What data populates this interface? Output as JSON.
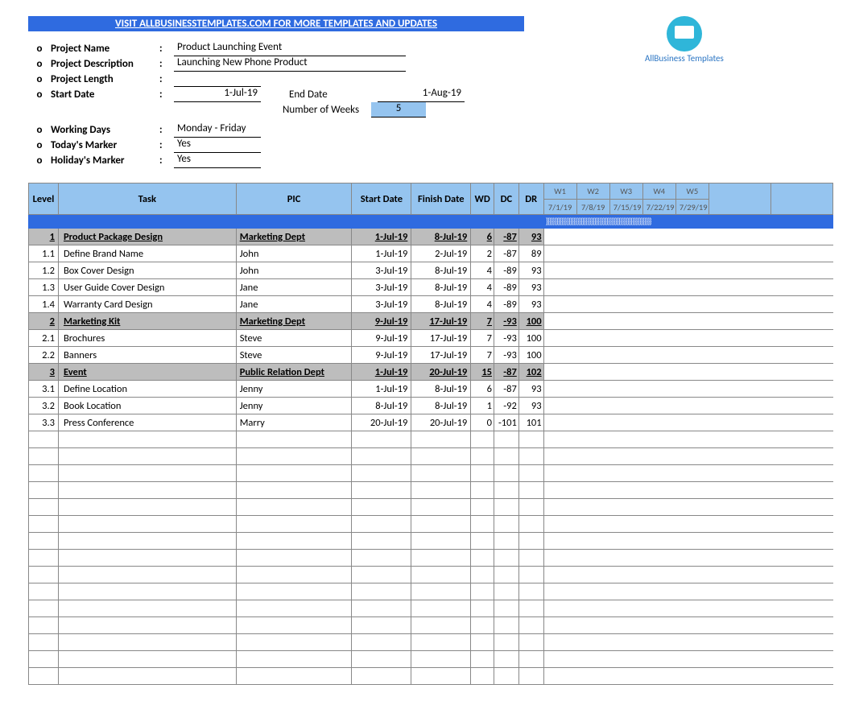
{
  "banner": "VISIT ALLBUSINESSTEMPLATES.COM FOR MORE TEMPLATES AND UPDATES",
  "logo_text": "AllBusiness Templates",
  "info": {
    "project_name_label": "Project Name",
    "project_name": "Product Launching Event",
    "project_desc_label": "Project Description",
    "project_desc": "Launching New Phone Product",
    "project_length_label": "Project Length",
    "project_length": "",
    "start_date_label": "Start Date",
    "start_date": "1-Jul-19",
    "end_date_label": "End Date",
    "end_date": "1-Aug-19",
    "num_weeks_label": "Number of Weeks",
    "num_weeks": "5",
    "working_days_label": "Working Days",
    "working_days": "Monday - Friday",
    "todays_marker_label": "Today's Marker",
    "todays_marker": "Yes",
    "holidays_marker_label": "Holiday's Marker",
    "holidays_marker": "Yes"
  },
  "columns": {
    "level": "Level",
    "task": "Task",
    "pic": "PIC",
    "start_date": "Start Date",
    "finish_date": "Finish Date",
    "wd": "WD",
    "dc": "DC",
    "dr": "DR"
  },
  "weeks": [
    {
      "label": "W1",
      "date": "7/1/19"
    },
    {
      "label": "W2",
      "date": "7/8/19"
    },
    {
      "label": "W3",
      "date": "7/15/19"
    },
    {
      "label": "W4",
      "date": "7/22/19"
    },
    {
      "label": "W5",
      "date": "7/29/19"
    }
  ],
  "gantt_label": "}}}}}}}}}}}}}}}}}}}}}}}}}}}}}}}}}}}}}}}}}}}}}}}}}}}}}}}}}}}}}",
  "rows": [
    {
      "group": true,
      "level": "1",
      "task": "Product Package Design",
      "pic": "Marketing Dept",
      "sd": "1-Jul-19",
      "fd": "8-Jul-19",
      "wd": "6",
      "dc": "-87",
      "dr": "93"
    },
    {
      "group": false,
      "level": "1.1",
      "task": "Define Brand Name",
      "pic": "John",
      "sd": "1-Jul-19",
      "fd": "2-Jul-19",
      "wd": "2",
      "dc": "-87",
      "dr": "89"
    },
    {
      "group": false,
      "level": "1.2",
      "task": "Box Cover Design",
      "pic": "John",
      "sd": "3-Jul-19",
      "fd": "8-Jul-19",
      "wd": "4",
      "dc": "-89",
      "dr": "93"
    },
    {
      "group": false,
      "level": "1.3",
      "task": "User Guide Cover Design",
      "pic": "Jane",
      "sd": "3-Jul-19",
      "fd": "8-Jul-19",
      "wd": "4",
      "dc": "-89",
      "dr": "93"
    },
    {
      "group": false,
      "level": "1.4",
      "task": "Warranty Card Design",
      "pic": "Jane",
      "sd": "3-Jul-19",
      "fd": "8-Jul-19",
      "wd": "4",
      "dc": "-89",
      "dr": "93"
    },
    {
      "group": true,
      "level": "2",
      "task": "Marketing Kit",
      "pic": "Marketing Dept",
      "sd": "9-Jul-19",
      "fd": "17-Jul-19",
      "wd": "7",
      "dc": "-93",
      "dr": "100"
    },
    {
      "group": false,
      "level": "2.1",
      "task": "Brochures",
      "pic": "Steve",
      "sd": "9-Jul-19",
      "fd": "17-Jul-19",
      "wd": "7",
      "dc": "-93",
      "dr": "100"
    },
    {
      "group": false,
      "level": "2.2",
      "task": "Banners",
      "pic": "Steve",
      "sd": "9-Jul-19",
      "fd": "17-Jul-19",
      "wd": "7",
      "dc": "-93",
      "dr": "100"
    },
    {
      "group": true,
      "level": "3",
      "task": "Event",
      "pic": "Public Relation Dept",
      "sd": "1-Jul-19",
      "fd": "20-Jul-19",
      "wd": "15",
      "dc": "-87",
      "dr": "102"
    },
    {
      "group": false,
      "level": "3.1",
      "task": "Define Location",
      "pic": "Jenny",
      "sd": "1-Jul-19",
      "fd": "8-Jul-19",
      "wd": "6",
      "dc": "-87",
      "dr": "93"
    },
    {
      "group": false,
      "level": "3.2",
      "task": "Book Location",
      "pic": "Jenny",
      "sd": "8-Jul-19",
      "fd": "8-Jul-19",
      "wd": "1",
      "dc": "-92",
      "dr": "93"
    },
    {
      "group": false,
      "level": "3.3",
      "task": "Press Conference",
      "pic": "Marry",
      "sd": "20-Jul-19",
      "fd": "20-Jul-19",
      "wd": "0",
      "dc": "-101",
      "dr": "101"
    }
  ],
  "empty_rows": 15
}
